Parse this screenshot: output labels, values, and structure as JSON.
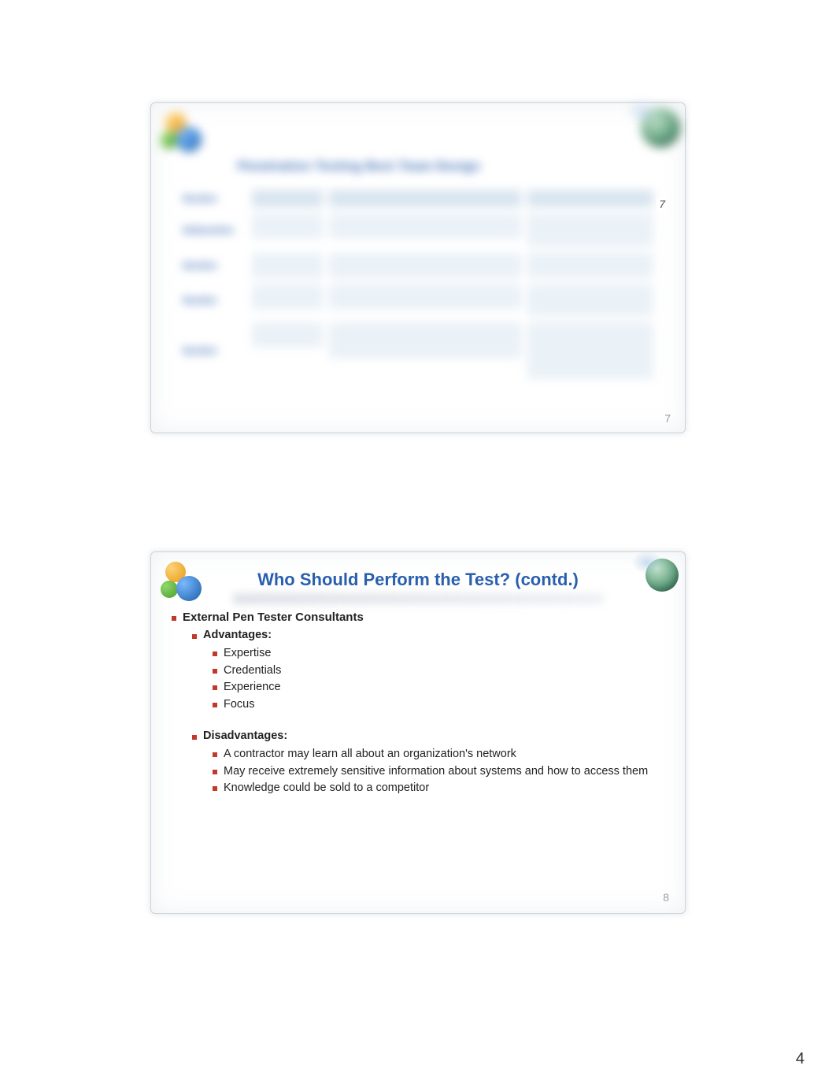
{
  "page_number_global": "4",
  "slide1": {
    "title_blurred": "Penetration Testing Best Team Design",
    "overlay_number": "7",
    "slide_number": "7",
    "row_labels": [
      "Section",
      "Subsection",
      "Section",
      "Section",
      "Section"
    ]
  },
  "slide2": {
    "title": "Who Should Perform the Test? (contd.)",
    "heading": "External Pen Tester Consultants",
    "advantages_label": "Advantages:",
    "advantages": [
      "Expertise",
      "Credentials",
      "Experience",
      "Focus"
    ],
    "disadvantages_label": "Disadvantages:",
    "disadvantages": [
      "A contractor may learn all about an organization's network",
      "May receive extremely sensitive information about systems and how to access them",
      "Knowledge could be sold to a competitor"
    ],
    "slide_number": "8"
  }
}
